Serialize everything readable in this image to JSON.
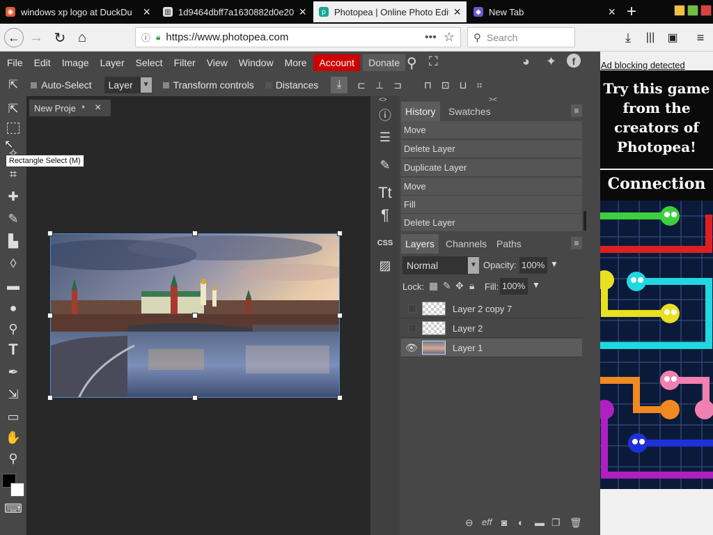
{
  "browser": {
    "tabs": [
      {
        "title": "windows xp logo at DuckDu",
        "favicon": "duckduckgo-icon"
      },
      {
        "title": "1d9464dbff7a1630882d0e20",
        "favicon": "page-icon"
      },
      {
        "title": "Photopea | Online Photo Edit",
        "favicon": "photopea-icon"
      },
      {
        "title": "New Tab",
        "favicon": "firefox-icon"
      }
    ],
    "url": "https://www.photopea.com",
    "search_placeholder": "Search"
  },
  "menu": [
    "File",
    "Edit",
    "Image",
    "Layer",
    "Select",
    "Filter",
    "View",
    "Window",
    "More"
  ],
  "account_label": "Account",
  "donate_label": "Donate",
  "options": {
    "auto_select": "Auto-Select",
    "auto_select_target": "Layer",
    "transform_controls": "Transform controls",
    "distances": "Distances"
  },
  "document_tab": "New Proje",
  "document_tab_modified": "*",
  "tooltip": "Rectangle Select (M)",
  "history": {
    "tab_history": "History",
    "tab_swatches": "Swatches",
    "items": [
      "Move",
      "Delete Layer",
      "Duplicate Layer",
      "Move",
      "Fill",
      "Delete Layer"
    ]
  },
  "layers_panel": {
    "tab_layers": "Layers",
    "tab_channels": "Channels",
    "tab_paths": "Paths",
    "blend_mode": "Normal",
    "opacity_label": "Opacity:",
    "opacity_value": "100%",
    "lock_label": "Lock:",
    "fill_label": "Fill:",
    "fill_value": "100%",
    "layers": [
      {
        "name": "Layer 2 copy 7",
        "visible": false
      },
      {
        "name": "Layer 2",
        "visible": false
      },
      {
        "name": "Layer 1",
        "visible": true,
        "selected": true
      }
    ]
  },
  "ad": {
    "blocker_text": "Ad blocking detected",
    "headline": "Try this game from the creators of Photopea!",
    "game_title": "Connection"
  }
}
